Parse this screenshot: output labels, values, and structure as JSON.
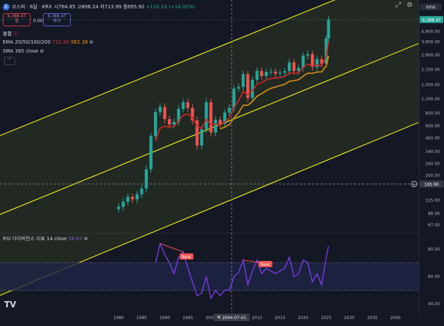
{
  "header": {
    "symbol": "코스피 · 6달 · KRX",
    "ohlc_open": "시784.85",
    "ohlc_high": "고896.24",
    "ohlc_low": "저713.99",
    "ohlc_close": "종895.92",
    "ohlc_change": "+110.13 (+14.02%)",
    "sell_price": "6,388.47",
    "sell_label": "셀",
    "buy_price": "6,388.47",
    "buy_label": "바이",
    "spread": "0.00"
  },
  "indicators": {
    "label_top": "볼륨",
    "ema_label": "EMA 20/50/100/200",
    "ema_val1": "712.30",
    "ema_val2": "562.38",
    "sma_label": "SMA 365 close",
    "rsi_label": "RSI 다이버전스 지표 14 close",
    "rsi_value": "56.83"
  },
  "price_axis": {
    "currency": "KRW",
    "current_price": "6,388.47",
    "crosshair_price": "165.90",
    "ticks": [
      "4,900.00",
      "3,900.00",
      "2,900.00",
      "2,100.00",
      "1,500.00",
      "1,100.00",
      "800.00",
      "600.00",
      "460.00",
      "340.00",
      "260.00",
      "200.00",
      "115.00",
      "86.00",
      "67.00"
    ]
  },
  "rsi_axis": {
    "ticks": [
      "80.00",
      "60.00",
      "40.00"
    ]
  },
  "time_axis": {
    "ticks": [
      "1980",
      "1985",
      "1990",
      "1995",
      "2000",
      "2005",
      "2010",
      "2015",
      "2020",
      "2025",
      "2030",
      "2035",
      "2040"
    ],
    "crosshair_label": "목 2004-07-01"
  },
  "annotations": {
    "bear1": "Bear",
    "bear2": "Bear"
  },
  "colors": {
    "up": "#26a69a",
    "down": "#ef5350",
    "channel": "#e8e81a",
    "ema_red": "#c62828",
    "ema_orange": "#d08a17",
    "rsi": "#7e3ff2"
  },
  "chart_data": {
    "type": "candlestick",
    "x_unit": "year",
    "y_scale": "log",
    "series": [
      {
        "name": "코스피",
        "points": [
          [
            1980,
            100
          ],
          [
            1981,
            112
          ],
          [
            1982,
            125
          ],
          [
            1983,
            118
          ],
          [
            1984,
            132
          ],
          [
            1985,
            150
          ],
          [
            1986,
            230
          ],
          [
            1987,
            480
          ],
          [
            1988,
            820
          ],
          [
            1989,
            920
          ],
          [
            1990,
            700
          ],
          [
            1991,
            620
          ],
          [
            1992,
            660
          ],
          [
            1993,
            880
          ],
          [
            1994,
            1020
          ],
          [
            1995,
            900
          ],
          [
            1996,
            680
          ],
          [
            1997,
            390
          ],
          [
            1998,
            560
          ],
          [
            1999,
            1020
          ],
          [
            2000,
            520
          ],
          [
            2001,
            690
          ],
          [
            2002,
            630
          ],
          [
            2003,
            810
          ],
          [
            2004,
            900
          ],
          [
            2005,
            1380
          ],
          [
            2006,
            1430
          ],
          [
            2007,
            1900
          ],
          [
            2008,
            1120
          ],
          [
            2009,
            1680
          ],
          [
            2010,
            2050
          ],
          [
            2011,
            1820
          ],
          [
            2012,
            2000
          ],
          [
            2013,
            2010
          ],
          [
            2014,
            1920
          ],
          [
            2015,
            1960
          ],
          [
            2016,
            2030
          ],
          [
            2017,
            2470
          ],
          [
            2018,
            2040
          ],
          [
            2019,
            2190
          ],
          [
            2020,
            2870
          ],
          [
            2021,
            2970
          ],
          [
            2022,
            2230
          ],
          [
            2023,
            2650
          ],
          [
            2024,
            2400
          ],
          [
            2025,
            4200
          ],
          [
            2025.5,
            6388.47
          ]
        ]
      }
    ],
    "rsi_series": [
      [
        1988,
        70
      ],
      [
        1989,
        84
      ],
      [
        1990,
        76
      ],
      [
        1991,
        70
      ],
      [
        1992,
        62
      ],
      [
        1993,
        74
      ],
      [
        1994,
        78
      ],
      [
        1995,
        66
      ],
      [
        1996,
        56
      ],
      [
        1997,
        46
      ],
      [
        1998,
        48
      ],
      [
        1999,
        60
      ],
      [
        2000,
        44
      ],
      [
        2001,
        50
      ],
      [
        2002,
        46
      ],
      [
        2003,
        50
      ],
      [
        2004,
        50
      ],
      [
        2005,
        60
      ],
      [
        2006,
        63
      ],
      [
        2007,
        72
      ],
      [
        2008,
        54
      ],
      [
        2009,
        64
      ],
      [
        2010,
        72
      ],
      [
        2011,
        62
      ],
      [
        2012,
        66
      ],
      [
        2013,
        64
      ],
      [
        2014,
        62
      ],
      [
        2015,
        64
      ],
      [
        2016,
        66
      ],
      [
        2017,
        74
      ],
      [
        2018,
        60
      ],
      [
        2019,
        62
      ],
      [
        2020,
        72
      ],
      [
        2021,
        70
      ],
      [
        2022,
        56
      ],
      [
        2023,
        62
      ],
      [
        2024,
        54
      ],
      [
        2025,
        74
      ],
      [
        2025.5,
        82
      ]
    ],
    "ylim": [
      60,
      9000
    ],
    "rsi_ylim": [
      30,
      90
    ]
  }
}
